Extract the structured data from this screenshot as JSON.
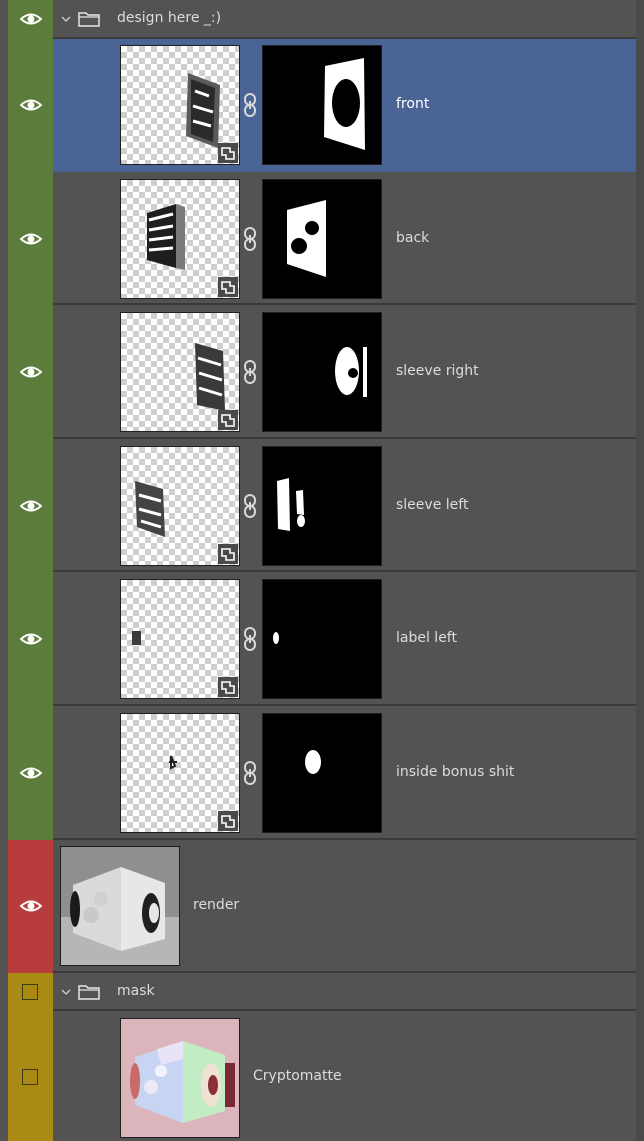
{
  "colors": {
    "panel_bg": "#535353",
    "selected_bg": "#4a6496",
    "green_tag": "#5b7c3a",
    "red_tag": "#b83c3c",
    "yellow_tag": "#a88a14"
  },
  "icons": {
    "visibility": "eye-icon",
    "group_toggle": "chevron-down-icon",
    "group": "folder-icon",
    "mask_link": "chain-link-icon",
    "smart_object": "smart-object-icon"
  },
  "group_design": {
    "name": "design here _:)",
    "expanded": true,
    "visible": true
  },
  "layers": [
    {
      "name": "front",
      "selected": true
    },
    {
      "name": "back",
      "selected": false
    },
    {
      "name": "sleeve right",
      "selected": false
    },
    {
      "name": "sleeve left",
      "selected": false
    },
    {
      "name": "label left",
      "selected": false
    },
    {
      "name": "inside bonus shit",
      "selected": false
    }
  ],
  "render_layer": {
    "name": "render",
    "visible": true
  },
  "group_mask": {
    "name": "mask",
    "expanded": true,
    "visible": false
  },
  "crypto_layer": {
    "name": "Cryptomatte",
    "visible": false
  }
}
